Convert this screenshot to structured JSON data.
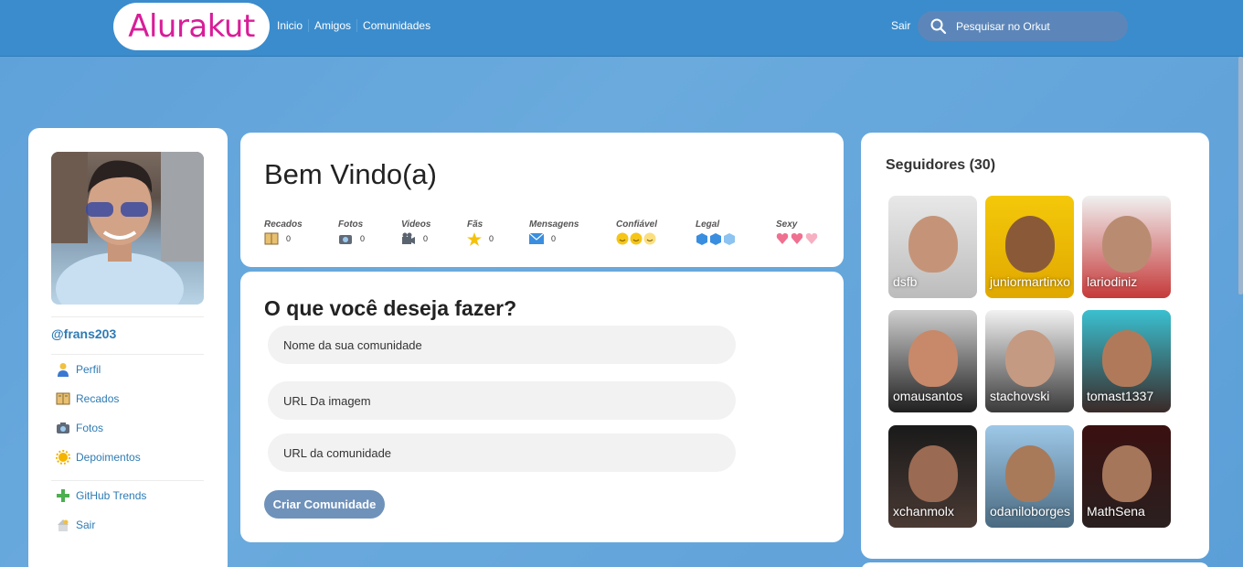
{
  "header": {
    "logo": "Alurakut",
    "nav": [
      "Inicio",
      "Amigos",
      "Comunidades"
    ],
    "logout": "Sair",
    "search_placeholder": "Pesquisar no Orkut"
  },
  "profile": {
    "username": "@frans203",
    "menu": [
      {
        "label": "Perfil",
        "icon": "user-icon"
      },
      {
        "label": "Recados",
        "icon": "book-icon"
      },
      {
        "label": "Fotos",
        "icon": "camera-icon"
      },
      {
        "label": "Depoimentos",
        "icon": "sun-icon"
      },
      {
        "label": "GitHub Trends",
        "icon": "plus-icon"
      },
      {
        "label": "Sair",
        "icon": "logout-icon"
      }
    ]
  },
  "welcome": {
    "title": "Bem Vindo(a)",
    "stats": [
      {
        "label": "Recados",
        "value": "0",
        "icon": "book-icon"
      },
      {
        "label": "Fotos",
        "value": "0",
        "icon": "camera-icon"
      },
      {
        "label": "Videos",
        "value": "0",
        "icon": "video-camera-icon"
      },
      {
        "label": "Fãs",
        "value": "0",
        "icon": "star-icon"
      },
      {
        "label": "Mensagens",
        "value": "0",
        "icon": "envelope-icon"
      },
      {
        "label": "Confiável",
        "rating": 3,
        "icon": "smiley-icon"
      },
      {
        "label": "Legal",
        "rating": 3,
        "icon": "ice-cube-icon"
      },
      {
        "label": "Sexy",
        "rating": 3,
        "icon": "heart-icon"
      }
    ]
  },
  "form": {
    "title": "O que você deseja fazer?",
    "fields": [
      {
        "placeholder": "Nome da sua comunidade"
      },
      {
        "placeholder": "URL Da imagem"
      },
      {
        "placeholder": "URL da comunidade"
      }
    ],
    "submit": "Criar Comunidade"
  },
  "followers": {
    "title": "Seguidores (30)",
    "items": [
      {
        "name": "dsfb"
      },
      {
        "name": "juniormartinxo"
      },
      {
        "name": "lariodiniz"
      },
      {
        "name": "omausantos"
      },
      {
        "name": "stachovski"
      },
      {
        "name": "tomast1337"
      },
      {
        "name": "xchanmolx"
      },
      {
        "name": "odaniloborges"
      },
      {
        "name": "MathSena"
      }
    ]
  }
}
